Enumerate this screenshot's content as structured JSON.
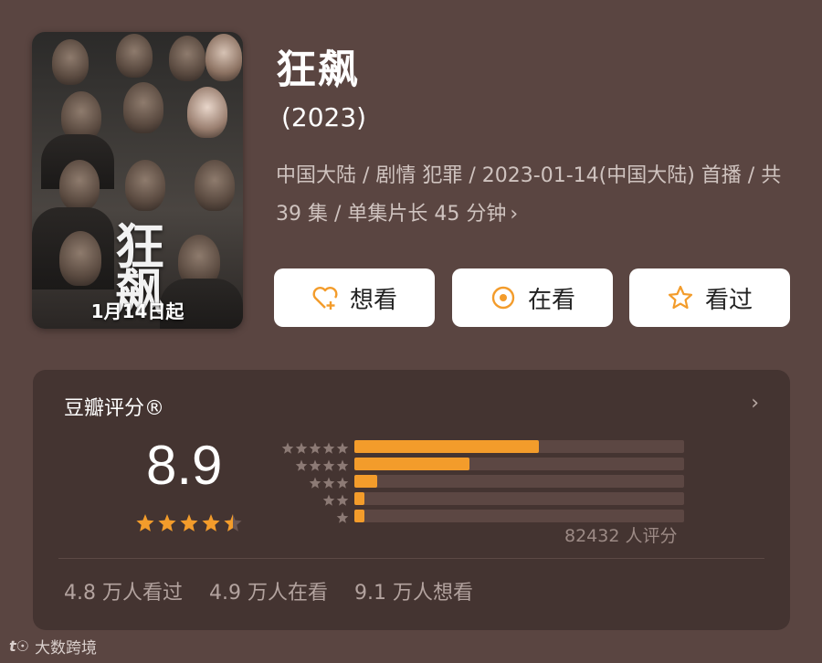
{
  "poster": {
    "title_text": "狂飙",
    "date_text": "1月14日起"
  },
  "show": {
    "title": "狂飙",
    "year": "(2023)",
    "meta": "中国大陆 / 剧情 犯罪 / 2023-01-14(中国大陆) 首播 / 共 39 集 / 单集片长 45 分钟",
    "meta_chevron": "›"
  },
  "actions": [
    {
      "label": "想看",
      "icon": "heart-plus-icon"
    },
    {
      "label": "在看",
      "icon": "target-icon"
    },
    {
      "label": "看过",
      "icon": "star-outline-icon"
    }
  ],
  "rating": {
    "title": "豆瓣评分®",
    "chevron": "›",
    "score": "8.9",
    "stars": 4.5,
    "distribution": [
      {
        "stars": 5,
        "fraction": 0.56
      },
      {
        "stars": 4,
        "fraction": 0.35
      },
      {
        "stars": 3,
        "fraction": 0.07
      },
      {
        "stars": 2,
        "fraction": 0.03
      },
      {
        "stars": 1,
        "fraction": 0.03
      }
    ],
    "count": "82432 人评分",
    "accent_color": "#f39c2b"
  },
  "stats": {
    "watched": "4.8 万人看过",
    "watching": "4.9 万人在看",
    "want": "9.1 万人想看"
  },
  "watermark": {
    "logo": "t☉",
    "text": "大数跨境"
  }
}
